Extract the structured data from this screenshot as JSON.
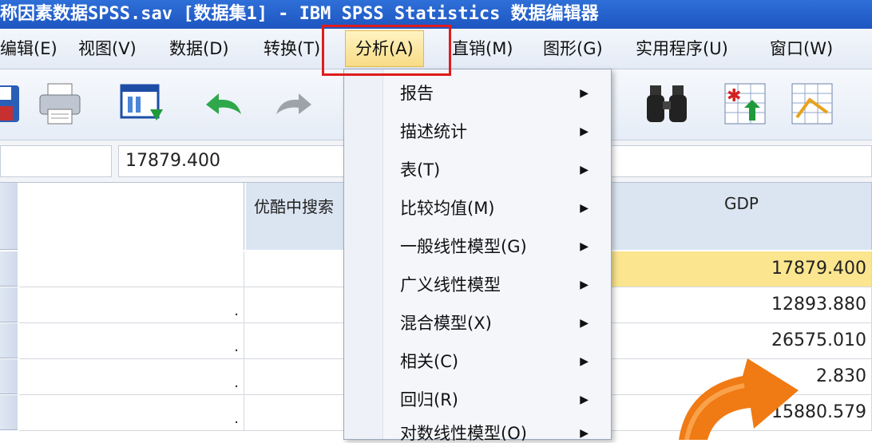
{
  "window": {
    "title": "称因素数据SPSS.sav [数据集1] - IBM SPSS Statistics 数据编辑器"
  },
  "menubar": {
    "items": [
      {
        "label": "编辑(E)"
      },
      {
        "label": "视图(V)"
      },
      {
        "label": "数据(D)"
      },
      {
        "label": "转换(T)"
      },
      {
        "label": "分析(A)"
      },
      {
        "label": "直销(M)"
      },
      {
        "label": "图形(G)"
      },
      {
        "label": "实用程序(U)"
      },
      {
        "label": "窗口(W)"
      }
    ],
    "active": "分析(A)"
  },
  "toolbar": {
    "icons": [
      "save-icon",
      "print-icon",
      "recall-dialog-icon",
      "undo-icon",
      "redo-icon",
      "find-icon",
      "insert-cases-icon",
      "chart-icon"
    ]
  },
  "refbar": {
    "value": "17879.400"
  },
  "grid": {
    "columns": [
      {
        "label": ""
      },
      {
        "label": "优酷中搜索"
      },
      {
        "label": "GDP"
      }
    ],
    "gdp_values": [
      "17879.400",
      "12893.880",
      "26575.010",
      "2.830",
      "15880.579"
    ],
    "missing_marker": "."
  },
  "analyze_menu": {
    "items": [
      {
        "label": "报告"
      },
      {
        "label": "描述统计"
      },
      {
        "label": "表(T)"
      },
      {
        "label": "比较均值(M)"
      },
      {
        "label": "一般线性模型(G)"
      },
      {
        "label": "广义线性模型"
      },
      {
        "label": "混合模型(X)"
      },
      {
        "label": "相关(C)"
      },
      {
        "label": "回归(R)"
      },
      {
        "label": "对数线性模型(O)"
      }
    ],
    "arrow": "▶"
  },
  "colors": {
    "highlight": "#e01b1b",
    "selected_cell": "#fbe58e",
    "overlay_arrow": "#f07a14"
  }
}
